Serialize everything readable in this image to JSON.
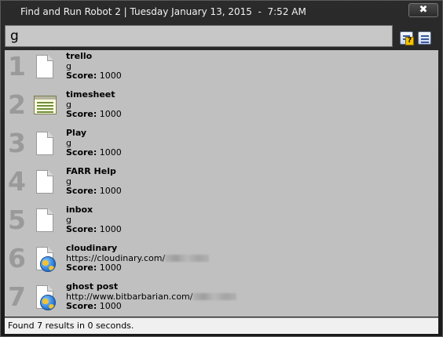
{
  "window": {
    "title": "Find and Run Robot 2 | Tuesday January 13, 2015  -  7:52 AM",
    "close_label": "✖"
  },
  "search": {
    "value": "g"
  },
  "toolbar": {
    "help_icon": "help-icon",
    "options_icon": "options-icon",
    "help_badge": "?"
  },
  "results": [
    {
      "rank": "1",
      "name": "trello",
      "sub": "g",
      "sub_blurred": false,
      "score_label": "Score:",
      "score": "1000",
      "icon": "page-icon"
    },
    {
      "rank": "2",
      "name": "timesheet",
      "sub": "g",
      "sub_blurred": false,
      "score_label": "Score:",
      "score": "1000",
      "icon": "spreadsheet-icon"
    },
    {
      "rank": "3",
      "name": "Play",
      "sub": "g",
      "sub_blurred": false,
      "score_label": "Score:",
      "score": "1000",
      "icon": "page-icon"
    },
    {
      "rank": "4",
      "name": "FARR Help",
      "sub": "g",
      "sub_blurred": false,
      "score_label": "Score:",
      "score": "1000",
      "icon": "page-icon"
    },
    {
      "rank": "5",
      "name": "inbox",
      "sub": "g",
      "sub_blurred": false,
      "score_label": "Score:",
      "score": "1000",
      "icon": "page-icon"
    },
    {
      "rank": "6",
      "name": "cloudinary",
      "sub": "https://cloudinary.com/",
      "sub_blurred": true,
      "score_label": "Score:",
      "score": "1000",
      "icon": "web-shortcut-icon"
    },
    {
      "rank": "7",
      "name": "ghost post",
      "sub": "http://www.bitbarbarian.com/",
      "sub_blurred": true,
      "score_label": "Score:",
      "score": "1000",
      "icon": "web-shortcut-icon"
    }
  ],
  "status": {
    "text": "Found 7 results in 0 seconds."
  }
}
